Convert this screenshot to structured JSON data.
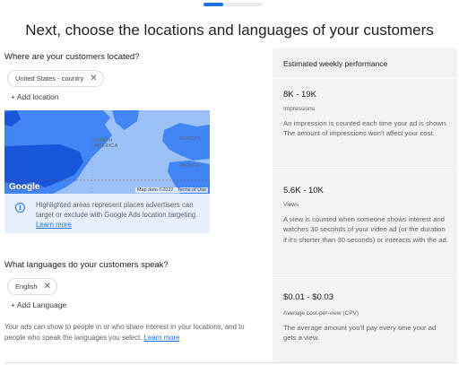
{
  "progress": {
    "fraction": 0.33
  },
  "page": {
    "title": "Next, choose the locations and languages of your customers"
  },
  "locations": {
    "question": "Where are your customers located?",
    "chips": [
      "United States - country"
    ],
    "add_label": "+ Add location",
    "map": {
      "logo_text": "Google",
      "data_credit": "Map data ©2022",
      "terms": "Terms of Use",
      "region_labels": [
        "NORTH\nAMERICA",
        "EUROPE",
        "AFRICA"
      ],
      "colors": {
        "water": "#9cc1f6",
        "land": "#4285f4",
        "highlight": "#1a56db"
      }
    },
    "info": {
      "icon": "info-icon",
      "text": "Highlighted areas represent places advertisers can target or exclude with Google Ads location targeting.",
      "link": "Learn more"
    }
  },
  "languages": {
    "question": "What languages do your customers speak?",
    "chips": [
      "English"
    ],
    "add_label": "+ Add Language",
    "footnote": "Your ads can show to people in or who share interest in your locations, and to people who speak the languages you select.",
    "footnote_link": "Learn more"
  },
  "performance": {
    "title": "Estimated weekly performance",
    "metrics": [
      {
        "value": "8K - 19K",
        "label": "Impressions",
        "description": "An impression is counted each time your ad is shown. The amount of impressions won't affect your cost."
      },
      {
        "value": "5.6K - 10K",
        "label": "Views",
        "description": "A view is counted when someone shows interest and watches 30 seconds of your video ad (or the duration if it's shorter than 30 seconds) or interacts with the ad."
      },
      {
        "value": "$0.01 - $0.03",
        "label": "Average cost-per-view (CPV)",
        "description": "The average amount you'll pay every time your ad gets a view."
      }
    ]
  },
  "colors": {
    "accent": "#1a73e8",
    "panel": "#f1f3f4",
    "info_bg": "#e8f0fe"
  }
}
